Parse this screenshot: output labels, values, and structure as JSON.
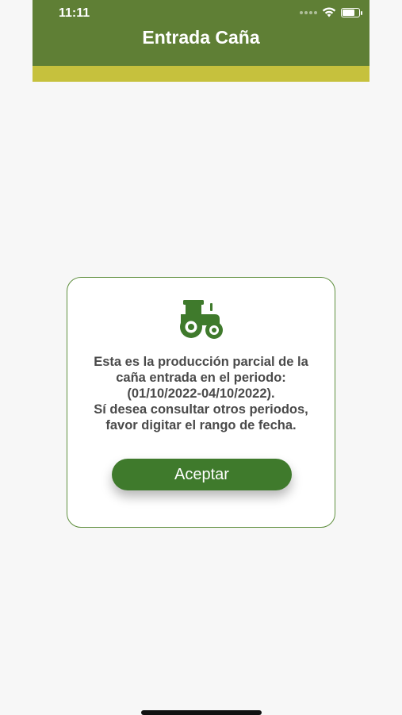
{
  "status_bar": {
    "time": "11:11",
    "battery_level": 0.85
  },
  "header": {
    "title": "Entrada Caña"
  },
  "dialog": {
    "icon": "tractor-icon",
    "message_lines": [
      "Esta es la producción parcial de la",
      "caña entrada en el periodo:",
      "(01/10/2022-04/10/2022).",
      "Sí desea consultar otros periodos,",
      "favor digitar el rango de fecha."
    ],
    "accept_label": "Aceptar"
  },
  "colors": {
    "header_green": "#5f7f35",
    "accent_yellow": "#c6c13d",
    "button_green": "#3f7a2c",
    "border_green": "#5f8f3e"
  }
}
